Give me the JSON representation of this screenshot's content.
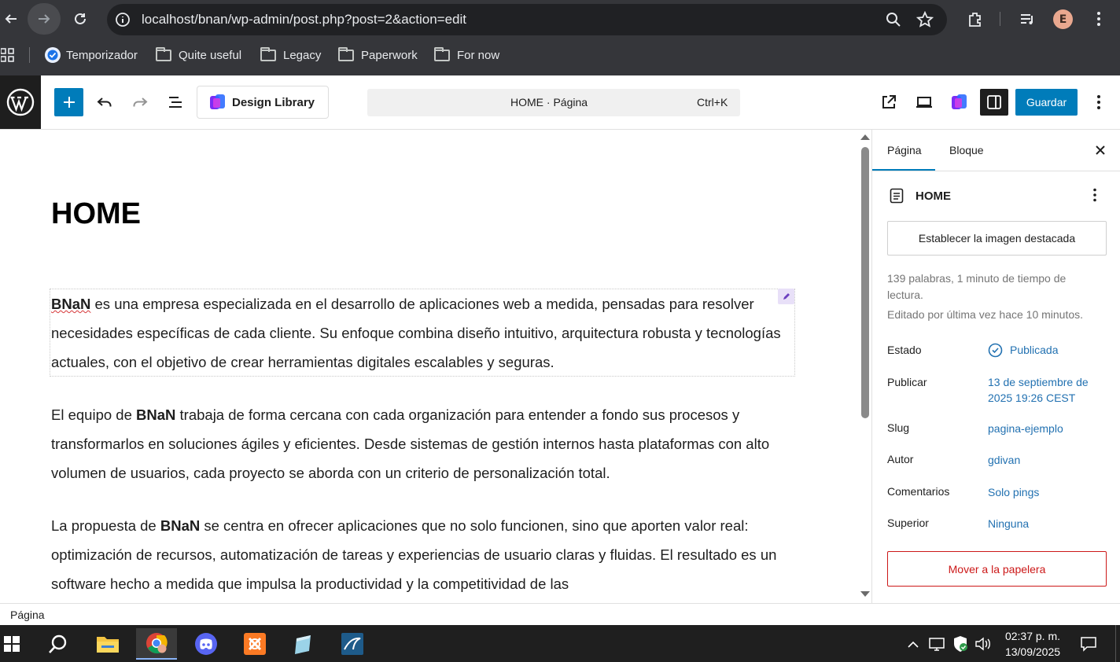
{
  "browser": {
    "url": "localhost/bnan/wp-admin/post.php?post=2&action=edit",
    "profile_initial": "E",
    "bookmarks": [
      {
        "label": "Temporizador"
      },
      {
        "label": "Quite useful"
      },
      {
        "label": "Legacy"
      },
      {
        "label": "Paperwork"
      },
      {
        "label": "For now"
      }
    ]
  },
  "toolbar": {
    "design_library_label": "Design Library",
    "command_title": "HOME · Página",
    "command_shortcut": "Ctrl+K",
    "save_label": "Guardar"
  },
  "editor": {
    "title": "HOME",
    "brand": "BNaN",
    "p1_rest": " es una empresa especializada en el desarrollo de aplicaciones web a medida, pensadas para resolver necesidades específicas de cada cliente. Su enfoque combina diseño intuitivo, arquitectura robusta y tecnologías actuales, con el objetivo de crear herramientas digitales escalables y seguras.",
    "p2_pre": "El equipo de ",
    "p2_rest": " trabaja de forma cercana con cada organización para entender a fondo sus procesos y transformarlos en soluciones ágiles y eficientes. Desde sistemas de gestión internos hasta plataformas con alto volumen de usuarios, cada proyecto se aborda con un criterio de personalización total.",
    "p3_pre": "La propuesta de ",
    "p3_rest": " se centra en ofrecer aplicaciones que no solo funcionen, sino que aporten valor real: optimización de recursos, automatización de tareas y experiencias de usuario claras y fluidas. El resultado es un software hecho a medida que impulsa la productividad y la competitividad de las"
  },
  "sidebar": {
    "tab_page": "Página",
    "tab_block": "Bloque",
    "doc_title": "HOME",
    "featured_image_label": "Establecer la imagen destacada",
    "stats": "139 palabras, 1 minuto de tiempo de lectura.",
    "edited": "Editado por última vez hace 10 minutos.",
    "rows": [
      {
        "label": "Estado",
        "value": "Publicada"
      },
      {
        "label": "Publicar",
        "value": "13 de septiembre de 2025 19:26 CEST"
      },
      {
        "label": "Slug",
        "value": "pagina-ejemplo"
      },
      {
        "label": "Autor",
        "value": "gdivan"
      },
      {
        "label": "Comentarios",
        "value": "Solo pings"
      },
      {
        "label": "Superior",
        "value": "Ninguna"
      }
    ],
    "trash_label": "Mover a la papelera"
  },
  "statusbar": {
    "label": "Página"
  },
  "taskbar": {
    "time": "02:37 p. m.",
    "date": "13/09/2025"
  },
  "colors": {
    "accent": "#007cba",
    "link": "#2271b1",
    "danger": "#cc1818"
  }
}
